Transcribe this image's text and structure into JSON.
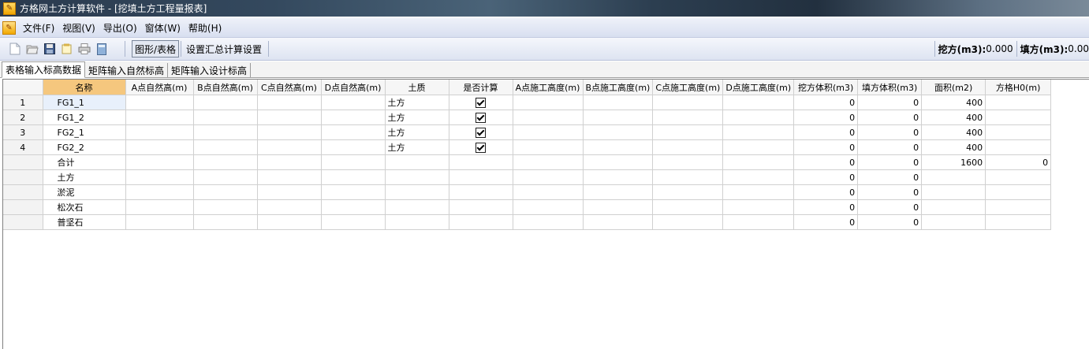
{
  "window": {
    "title": "方格网土方计算软件 - [挖填土方工程量报表]"
  },
  "menubar": {
    "items": [
      "文件(F)",
      "视图(V)",
      "导出(O)",
      "窗体(W)",
      "帮助(H)"
    ]
  },
  "toolbar": {
    "buttons": [
      "new-icon",
      "open-icon",
      "save-icon",
      "note-icon",
      "print-icon",
      "calc-icon"
    ],
    "toggle_label": "图形/表格",
    "settings_label": "设置汇总计算设置",
    "excavation_label": "挖方(m3):",
    "excavation_value": "0.000",
    "fill_label": "填方(m3):",
    "fill_value": "0.00"
  },
  "tabs": [
    "表格输入标高数据",
    "矩阵输入自然标高",
    "矩阵输入设计标高"
  ],
  "grid": {
    "columns": [
      "",
      "名称",
      "A点自然高(m)",
      "B点自然高(m)",
      "C点自然高(m)",
      "D点自然高(m)",
      "土质",
      "是否计算",
      "A点施工高度(m)",
      "B点施工高度(m)",
      "C点施工高度(m)",
      "D点施工高度(m)",
      "挖方体积(m3)",
      "填方体积(m3)",
      "面积(m2)",
      "方格H0(m)"
    ],
    "rows": [
      {
        "no": "1",
        "name": "FG1_1",
        "soil": "土方",
        "calc": true,
        "cut": "0",
        "fill": "0",
        "area": "400",
        "h0": ""
      },
      {
        "no": "2",
        "name": "FG1_2",
        "soil": "土方",
        "calc": true,
        "cut": "0",
        "fill": "0",
        "area": "400",
        "h0": ""
      },
      {
        "no": "3",
        "name": "FG2_1",
        "soil": "土方",
        "calc": true,
        "cut": "0",
        "fill": "0",
        "area": "400",
        "h0": ""
      },
      {
        "no": "4",
        "name": "FG2_2",
        "soil": "土方",
        "calc": true,
        "cut": "0",
        "fill": "0",
        "area": "400",
        "h0": ""
      },
      {
        "no": "",
        "name": "合计",
        "soil": "",
        "calc": false,
        "cut": "0",
        "fill": "0",
        "area": "1600",
        "h0": "0"
      },
      {
        "no": "",
        "name": "土方",
        "soil": "",
        "calc": false,
        "cut": "0",
        "fill": "0",
        "area": "",
        "h0": ""
      },
      {
        "no": "",
        "name": "淤泥",
        "soil": "",
        "calc": false,
        "cut": "0",
        "fill": "0",
        "area": "",
        "h0": ""
      },
      {
        "no": "",
        "name": "松次石",
        "soil": "",
        "calc": false,
        "cut": "0",
        "fill": "0",
        "area": "",
        "h0": ""
      },
      {
        "no": "",
        "name": "普坚石",
        "soil": "",
        "calc": false,
        "cut": "0",
        "fill": "0",
        "area": "",
        "h0": ""
      }
    ]
  },
  "colors": {
    "selected_header": "#f5c77e",
    "selected_cell": "#e8f0fb"
  }
}
